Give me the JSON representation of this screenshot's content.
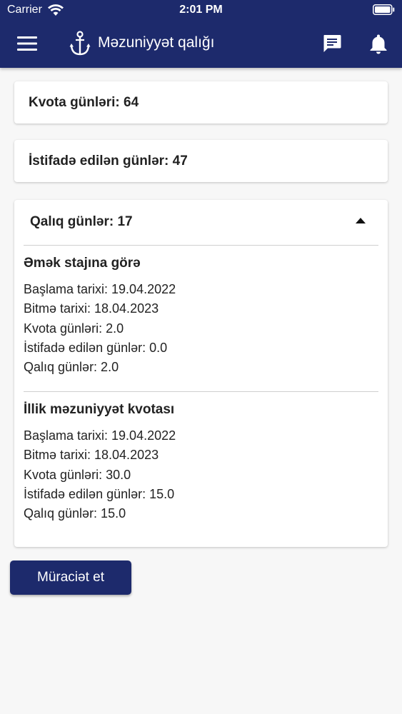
{
  "status_bar": {
    "carrier": "Carrier",
    "time": "2:01 PM"
  },
  "header": {
    "title": "Məzuniyyət qalığı",
    "icons": [
      "menu-icon",
      "anchor-icon",
      "chat-icon",
      "bell-icon"
    ],
    "background_color": "#1d2a6c"
  },
  "summary": {
    "quota_days": "Kvota günləri: 64",
    "used_days": "İstifadə edilən günlər: 47"
  },
  "remaining": {
    "title": "Qalıq günlər: 17",
    "expanded": true,
    "sections": [
      {
        "title": "Əmək stajına görə",
        "lines": [
          "Başlama tarixi: 19.04.2022",
          "Bitmə tarixi: 18.04.2023",
          "Kvota günləri: 2.0",
          "İstifadə edilən günlər: 0.0",
          "Qalıq günlər: 2.0"
        ]
      },
      {
        "title": "İllik məzuniyyət kvotası",
        "lines": [
          "Başlama tarixi: 19.04.2022",
          "Bitmə tarixi: 18.04.2023",
          "Kvota günləri: 30.0",
          "İstifadə edilən günlər: 15.0",
          "Qalıq günlər: 15.0"
        ]
      }
    ]
  },
  "actions": {
    "apply_label": "Müraciət et"
  }
}
